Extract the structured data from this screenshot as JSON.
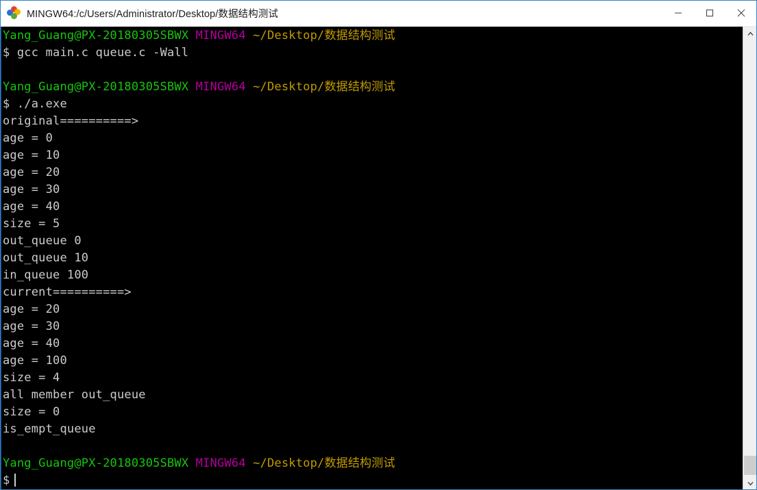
{
  "window": {
    "title": "MINGW64:/c/Users/Administrator/Desktop/数据结构测试",
    "app_icon": "gitbash-logo-icon",
    "minimize_label": "—",
    "maximize_label": "□",
    "close_label": "✕"
  },
  "colors": {
    "titlebar_bg": "#ffffff",
    "title_text": "#1b1b1b",
    "terminal_bg": "#000000",
    "text_default": "#cccccc",
    "user_green": "#16c60c",
    "host_magenta": "#b4009e",
    "path_yellow": "#c19c00",
    "window_border": "#2f7ec4",
    "scrollbar_bg": "#f0f0f0",
    "scrollbar_thumb": "#cdcdcd"
  },
  "terminal": {
    "prompt": {
      "user_host": "Yang_Guang@PX-20180305SBWX",
      "shell": "MINGW64",
      "path": "~/Desktop/数据结构测试",
      "symbol": "$"
    },
    "lines": [
      {
        "type": "prompt"
      },
      {
        "type": "command",
        "text": "$ gcc main.c queue.c -Wall"
      },
      {
        "type": "blank",
        "text": ""
      },
      {
        "type": "prompt"
      },
      {
        "type": "command",
        "text": "$ ./a.exe"
      },
      {
        "type": "output",
        "text": "original==========>"
      },
      {
        "type": "output",
        "text": "age = 0"
      },
      {
        "type": "output",
        "text": "age = 10"
      },
      {
        "type": "output",
        "text": "age = 20"
      },
      {
        "type": "output",
        "text": "age = 30"
      },
      {
        "type": "output",
        "text": "age = 40"
      },
      {
        "type": "output",
        "text": "size = 5"
      },
      {
        "type": "output",
        "text": "out_queue 0"
      },
      {
        "type": "output",
        "text": "out_queue 10"
      },
      {
        "type": "output",
        "text": "in_queue 100"
      },
      {
        "type": "output",
        "text": "current==========>"
      },
      {
        "type": "output",
        "text": "age = 20"
      },
      {
        "type": "output",
        "text": "age = 30"
      },
      {
        "type": "output",
        "text": "age = 40"
      },
      {
        "type": "output",
        "text": "age = 100"
      },
      {
        "type": "output",
        "text": "size = 4"
      },
      {
        "type": "output",
        "text": "all member out_queue"
      },
      {
        "type": "output",
        "text": "size = 0"
      },
      {
        "type": "output",
        "text": "is_empt_queue"
      },
      {
        "type": "blank",
        "text": ""
      },
      {
        "type": "prompt"
      },
      {
        "type": "cursor",
        "text": "$"
      }
    ]
  },
  "scrollbar": {
    "up_arrow": "▲",
    "down_arrow": "▼",
    "thumb_position": "bottom"
  }
}
